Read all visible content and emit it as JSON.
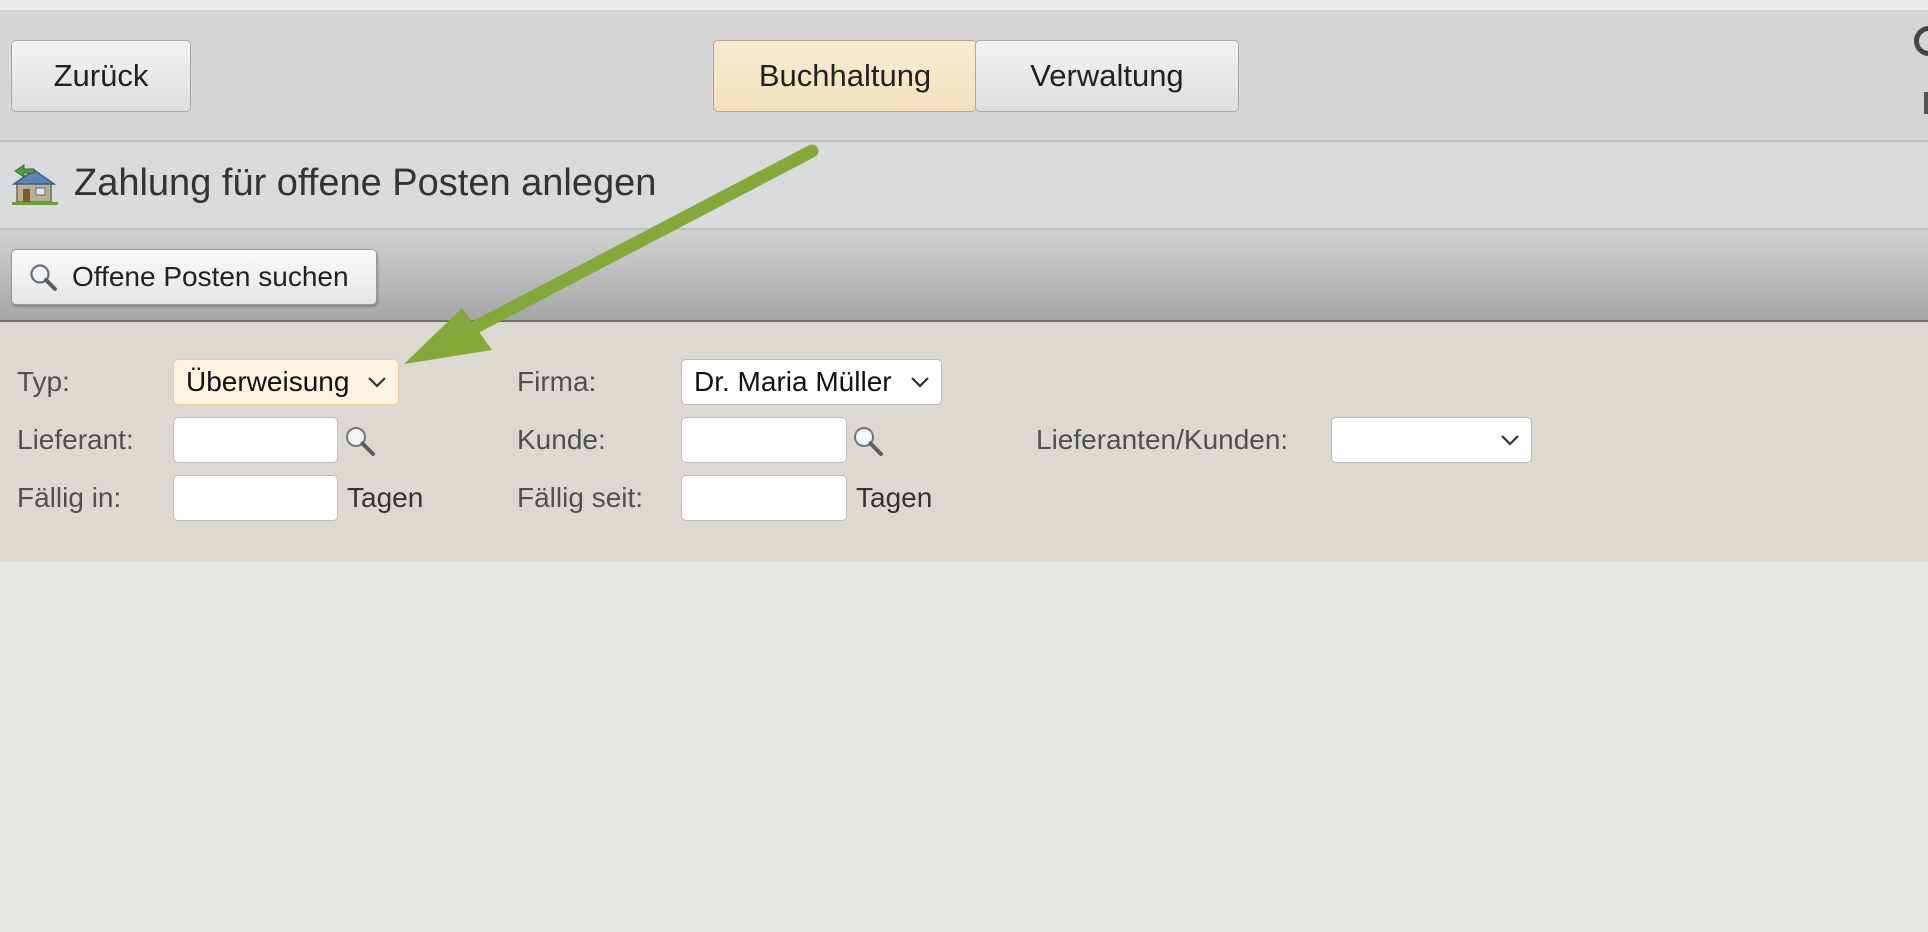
{
  "header": {
    "back_label": "Zurück",
    "tabs": [
      {
        "label": "Buchhaltung",
        "active": true
      },
      {
        "label": "Verwaltung",
        "active": false
      }
    ]
  },
  "title": {
    "text": "Zahlung für offene Posten anlegen",
    "icon": "payment-house-icon"
  },
  "toolbar": {
    "search_label": "Offene Posten suchen",
    "search_icon": "magnifier-icon"
  },
  "filters": {
    "typ": {
      "label": "Typ:",
      "value": "Überweisung"
    },
    "firma": {
      "label": "Firma:",
      "value": "Dr. Maria Müller"
    },
    "lieferant": {
      "label": "Lieferant:",
      "value": ""
    },
    "kunde": {
      "label": "Kunde:",
      "value": ""
    },
    "lieferanten_kunden": {
      "label": "Lieferanten/Kunden:",
      "value": ""
    },
    "faellig_in": {
      "label": "Fällig in:",
      "value": "",
      "unit": "Tagen"
    },
    "faellig_seit": {
      "label": "Fällig seit:",
      "value": "",
      "unit": "Tagen"
    }
  },
  "colors": {
    "active_tab": "#f1e0bb",
    "annotation_arrow": "#85a83a",
    "filter_background": "#dcd9d2"
  }
}
